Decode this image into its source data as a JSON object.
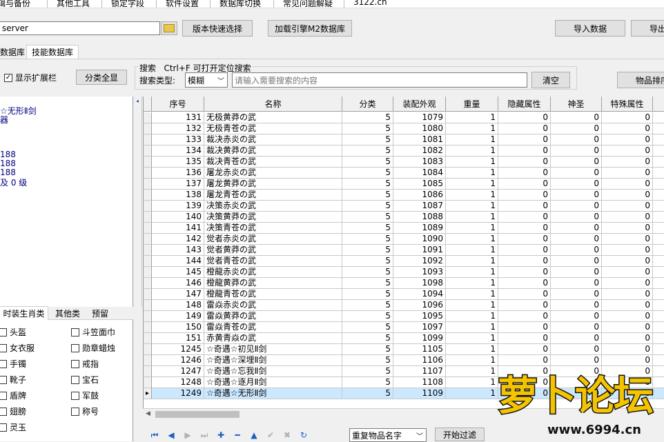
{
  "menu": [
    "编辑与备份",
    "其他工具",
    "锁定字段",
    "软件设置",
    "数据库切换",
    "常见问题解疑",
    "3122.cn"
  ],
  "toolbar": {
    "server_value": "server",
    "version_button": "版本快速选择",
    "load_button": "加载引擎M2数据库",
    "import_button": "导入数据",
    "export_button": "导出"
  },
  "db_tabs": [
    "数据库",
    "技能数据库"
  ],
  "options": {
    "show_ext_checkbox": "显示扩展栏",
    "category_all_button": "分类全显"
  },
  "search": {
    "group_title": "搜索",
    "hint": "Ctrl+F 可打开定位搜索",
    "type_label": "搜索类型:",
    "type_value": "模糊",
    "placeholder": "请输入需要搜索的内容",
    "clear_button": "清空"
  },
  "item_sort_button": "物品排序",
  "left_detail_lines": [
    "☆无形Ⅱ剑",
    "器",
    "",
    "",
    "",
    "188",
    "188",
    "188",
    "及 0 级"
  ],
  "category_tabs": [
    "时装生肖类",
    "其他类",
    "预留"
  ],
  "category_items": [
    [
      "头盔",
      "斗笠面巾"
    ],
    [
      "女衣服",
      "勋章蜡烛"
    ],
    [
      "手镯",
      "戒指"
    ],
    [
      "靴子",
      "宝石"
    ],
    [
      "盾牌",
      "军鼓"
    ],
    [
      "翅膀",
      "称号"
    ],
    [
      "灵玉",
      ""
    ]
  ],
  "table": {
    "columns": [
      "序号",
      "名称",
      "分类",
      "装配外观",
      "重量",
      "隐藏属性",
      "神圣",
      "特殊属性"
    ],
    "rows": [
      [
        "131",
        "无极黄莽の武",
        "5",
        "1079",
        "1",
        "0",
        "0",
        "0"
      ],
      [
        "132",
        "无极青苍の武",
        "5",
        "1080",
        "1",
        "0",
        "0",
        "0"
      ],
      [
        "133",
        "裁决赤炎の武",
        "5",
        "1081",
        "1",
        "0",
        "0",
        "0"
      ],
      [
        "134",
        "裁决黄莽の武",
        "5",
        "1082",
        "1",
        "0",
        "0",
        "0"
      ],
      [
        "135",
        "裁决青苍の武",
        "5",
        "1083",
        "1",
        "0",
        "0",
        "0"
      ],
      [
        "136",
        "屠龙赤炎の武",
        "5",
        "1084",
        "1",
        "0",
        "0",
        "0"
      ],
      [
        "137",
        "屠龙黄莽の武",
        "5",
        "1085",
        "1",
        "0",
        "0",
        "0"
      ],
      [
        "138",
        "屠龙青苍の武",
        "5",
        "1086",
        "1",
        "0",
        "0",
        "0"
      ],
      [
        "139",
        "决策赤炎の武",
        "5",
        "1087",
        "1",
        "0",
        "0",
        "0"
      ],
      [
        "140",
        "决策黄莽の武",
        "5",
        "1088",
        "1",
        "0",
        "0",
        "0"
      ],
      [
        "141",
        "决策青苍の武",
        "5",
        "1089",
        "1",
        "0",
        "0",
        "0"
      ],
      [
        "142",
        "觉者赤炎の武",
        "5",
        "1090",
        "1",
        "0",
        "0",
        "0"
      ],
      [
        "143",
        "觉者黄莽の武",
        "5",
        "1091",
        "1",
        "0",
        "0",
        "0"
      ],
      [
        "144",
        "觉者青苍の武",
        "5",
        "1092",
        "1",
        "0",
        "0",
        "0"
      ],
      [
        "145",
        "橙龍赤炎の武",
        "5",
        "1093",
        "1",
        "0",
        "0",
        "0"
      ],
      [
        "146",
        "橙龍黄莽の武",
        "5",
        "1098",
        "1",
        "0",
        "0",
        "0"
      ],
      [
        "147",
        "橙龍青苍の武",
        "5",
        "1094",
        "1",
        "0",
        "0",
        "0"
      ],
      [
        "148",
        "雷焱赤炎の武",
        "5",
        "1096",
        "1",
        "0",
        "0",
        "0"
      ],
      [
        "149",
        "雷焱黄莽の武",
        "5",
        "1095",
        "1",
        "0",
        "0",
        "0"
      ],
      [
        "150",
        "雷焱青苍の武",
        "5",
        "1097",
        "1",
        "0",
        "0",
        "0"
      ],
      [
        "151",
        "赤黄青焱の武",
        "5",
        "1099",
        "1",
        "0",
        "0",
        "0"
      ],
      [
        "1245",
        "☆奇遇☆初见Ⅱ剑",
        "5",
        "1105",
        "1",
        "0",
        "0",
        "0"
      ],
      [
        "1246",
        "☆奇遇☆深埋Ⅱ剑",
        "5",
        "1106",
        "1",
        "0",
        "0",
        "0"
      ],
      [
        "1247",
        "☆奇遇☆忘我Ⅱ剑",
        "5",
        "1107",
        "1",
        "0",
        "0",
        "0"
      ],
      [
        "1248",
        "☆奇遇☆逐月Ⅱ剑",
        "5",
        "1108",
        "1",
        "0",
        "0",
        "0"
      ],
      [
        "1249",
        "☆奇遇☆无形Ⅱ剑",
        "5",
        "1109",
        "1",
        "0",
        "0",
        "0"
      ]
    ],
    "selected_row": 25
  },
  "bottom": {
    "repeat_select_value": "重复物品名字",
    "filter_button": "开始过滤"
  },
  "watermark": {
    "text": "萝卜论坛",
    "url": "www.6994.cn"
  },
  "colors": {
    "selection": "#cce8ff",
    "nav_icon": "#1e5fc8",
    "detail_text": "#000080"
  }
}
